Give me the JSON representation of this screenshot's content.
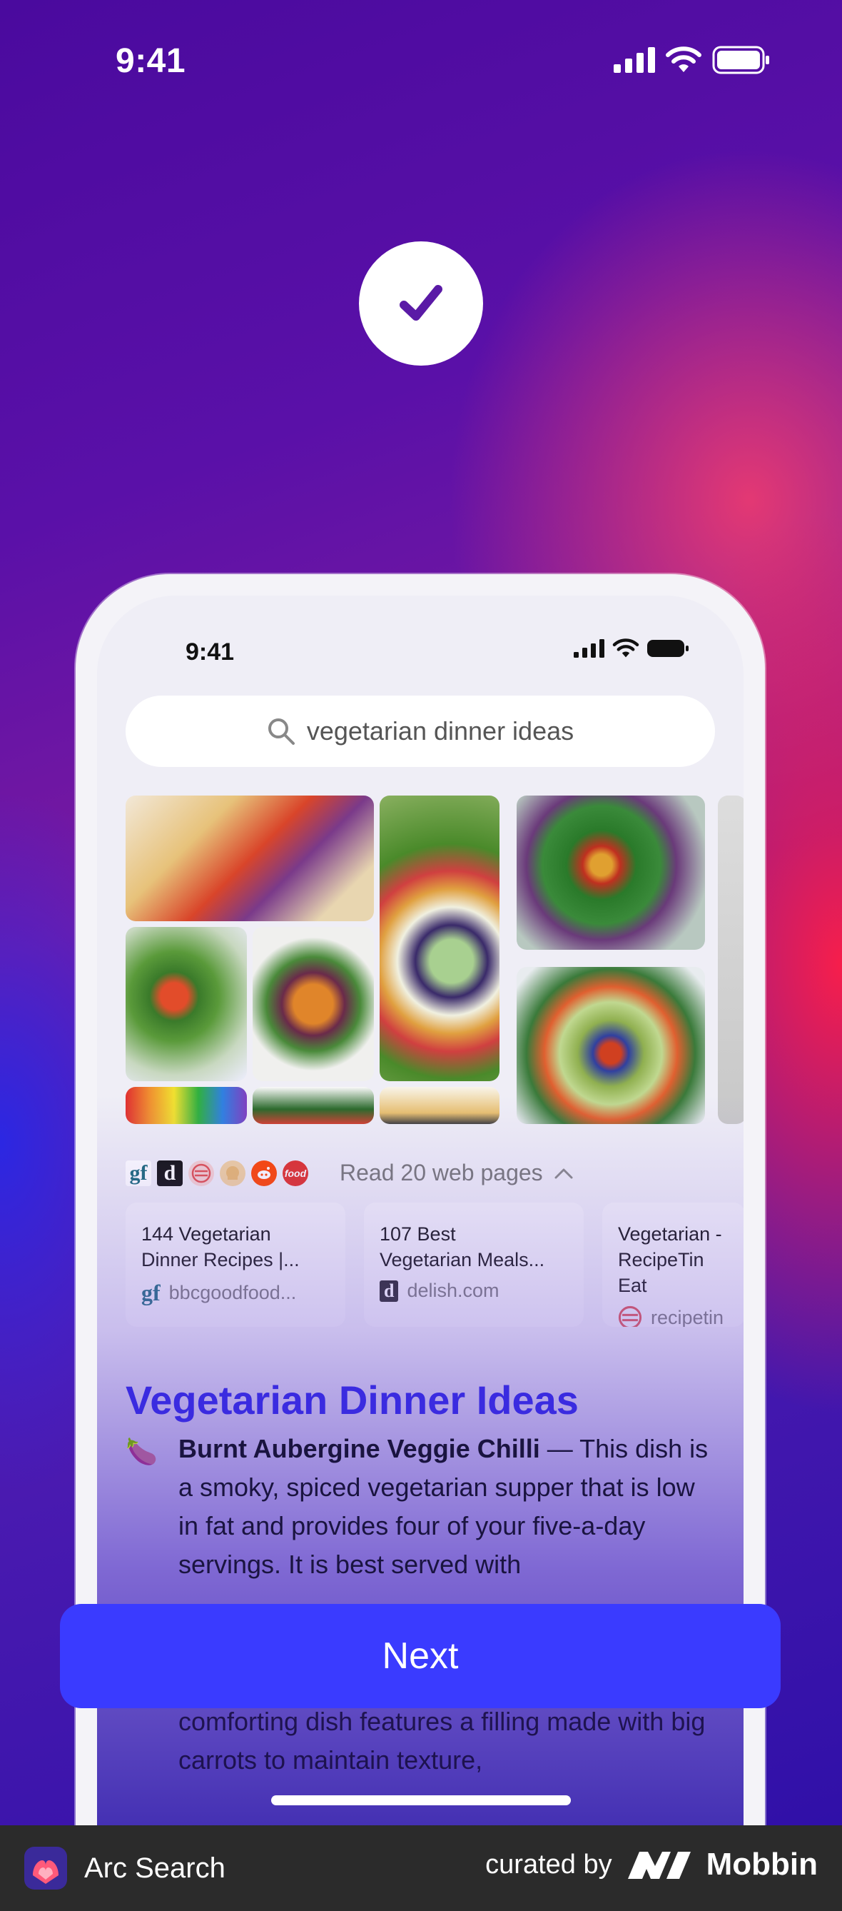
{
  "status_bar": {
    "time": "9:41"
  },
  "device": {
    "time": "9:41",
    "search": {
      "query": "vegetarian dinner ideas"
    },
    "sources": {
      "icons": [
        "gf",
        "d",
        "recipetin",
        "chef",
        "reddit",
        "food"
      ],
      "read_label": "Read 20 web pages"
    },
    "cards": [
      {
        "title": "144 Vegetarian\nDinner Recipes |...",
        "source_icon": "gf",
        "source": "bbcgoodfood..."
      },
      {
        "title": "107 Best\nVegetarian Meals...",
        "source_icon": "d",
        "source": "delish.com"
      },
      {
        "title": "Vegetarian -\nRecipeTin Eat",
        "source_icon": "recipetin",
        "source": "recipetin"
      }
    ],
    "heading": "Vegetarian Dinner Ideas",
    "paragraph": {
      "emoji": "🍆",
      "bold": "Burnt Aubergine Veggie Chilli",
      "text": " — This dish is a smoky, spiced vegetarian supper that is low in fat and provides four of your five-a-day servings. It is best served with"
    },
    "paragraph2": "comforting dish features a filling made with big carrots to maintain texture,"
  },
  "next_button": {
    "label": "Next"
  },
  "footer": {
    "app_name": "Arc Search",
    "curated_by": "curated by",
    "mobbin": "Mobbin"
  },
  "colors": {
    "accent": "#3a3bff",
    "heading": "#3a2be0",
    "footer_bg": "#2b2b2b"
  }
}
